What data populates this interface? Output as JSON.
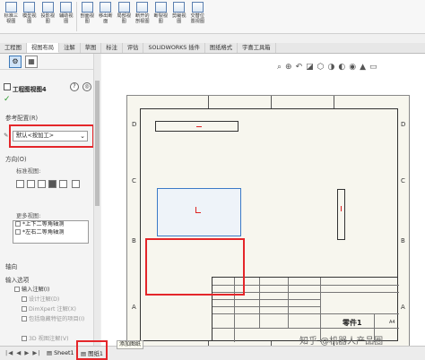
{
  "ribbon": [
    {
      "label": "标准三\n视图",
      "icon": "standard-views-icon"
    },
    {
      "label": "模型视\n图",
      "icon": "model-view-icon"
    },
    {
      "label": "投影视\n图",
      "icon": "projected-view-icon"
    },
    {
      "label": "辅助视\n图",
      "icon": "auxiliary-view-icon"
    },
    {
      "label": "剖面视\n图",
      "icon": "section-view-icon"
    },
    {
      "label": "移出断\n面",
      "icon": "removed-section-icon"
    },
    {
      "label": "局部视\n图",
      "icon": "detail-view-icon"
    },
    {
      "label": "断开的\n剖视图",
      "icon": "broken-out-section-icon"
    },
    {
      "label": "断裂视\n图",
      "icon": "break-view-icon"
    },
    {
      "label": "剪裁视\n图",
      "icon": "crop-view-icon"
    },
    {
      "label": "交替位\n置视图",
      "icon": "alternate-position-icon"
    }
  ],
  "tabs": [
    "工程图",
    "视图布局",
    "注解",
    "草图",
    "标注",
    "评估",
    "SOLIDWORKS 插件",
    "图纸格式",
    "宇喜工具箱"
  ],
  "active_tab": "视图布局",
  "panel": {
    "title": "工程图视图4",
    "ref_config_label": "参考配置(R)",
    "ref_config_value": "默认<按加工>",
    "orientation_label": "方向(O)",
    "standard_views_label": "标准视图:",
    "more_views_label": "更多视图:",
    "more_views": [
      "*上下二等角轴测",
      "*左右二等角轴测"
    ],
    "import_label": "输入选项",
    "import_annotations": "输入注解(I)",
    "design_annotations": "设计注解(D)",
    "dimxpert": "DimXpert 注解(X)",
    "hidden_features": "包括隐藏特征的项目(I)",
    "three_d_views": "3D 视图注解(V)",
    "origin_label": "轴向"
  },
  "hud_icons": [
    "zoom-fit-icon",
    "zoom-area-icon",
    "previous-view-icon",
    "section-icon",
    "view-orientation-icon",
    "display-style-icon",
    "hide-show-icon",
    "appearance-icon",
    "scene-icon",
    "monitor-icon"
  ],
  "sheet": {
    "row_labels": [
      "D",
      "C",
      "B",
      "A"
    ],
    "part_name": "零件1",
    "scale": "A4"
  },
  "bottom": {
    "sheet_tab": "Sheet1",
    "drawing_tab": "图纸1",
    "tooltip": "添加图纸",
    "nav": "|◀ ◀ ▶ ▶|"
  },
  "watermark": "知乎 @机器人产品圈"
}
